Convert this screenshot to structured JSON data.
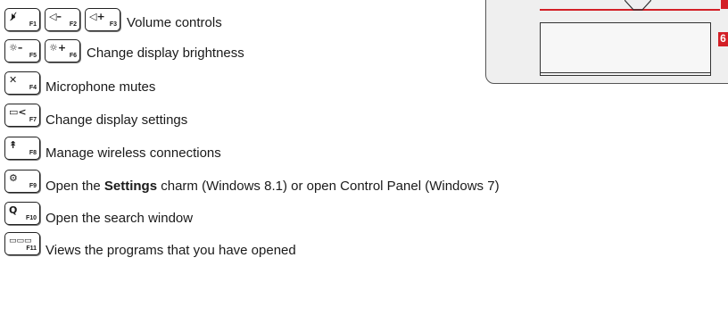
{
  "keys": {
    "mute": {
      "glyph": "🕨̸",
      "fn": "F1",
      "icon": "speaker-mute-icon"
    },
    "vol_down": {
      "glyph": "◁–",
      "fn": "F2",
      "icon": "volume-down-icon"
    },
    "vol_up": {
      "glyph": "◁+",
      "fn": "F3",
      "icon": "volume-up-icon"
    },
    "mic_mute": {
      "glyph": "✕",
      "fn": "F4",
      "icon": "microphone-mute-icon"
    },
    "bright_down": {
      "glyph": "☼–",
      "fn": "F5",
      "icon": "brightness-down-icon"
    },
    "bright_up": {
      "glyph": "☼+",
      "fn": "F6",
      "icon": "brightness-up-icon"
    },
    "display": {
      "glyph": "▭<",
      "fn": "F7",
      "icon": "display-switch-icon"
    },
    "wireless": {
      "glyph": "↟",
      "fn": "F8",
      "icon": "wireless-icon"
    },
    "settings": {
      "glyph": "⚙",
      "fn": "F9",
      "icon": "gear-icon"
    },
    "search": {
      "glyph": "Q",
      "fn": "F10",
      "icon": "search-icon"
    },
    "programs": {
      "glyph": "▭▭▭",
      "fn": "F11",
      "icon": "task-view-icon"
    }
  },
  "descriptions": {
    "volume": "Volume controls",
    "brightness": "Change display brightness",
    "microphone": "Microphone mutes",
    "display": "Change display settings",
    "wireless": "Manage wireless connections",
    "settings_pre": "Open the ",
    "settings_bold": "Settings",
    "settings_post": " charm (Windows 8.1) or open Control Panel (Windows 7)",
    "search": "Open the search window",
    "programs": "Views the programs that you have opened"
  },
  "panel": {
    "marker_top": "",
    "marker_bottom": "6"
  },
  "colors": {
    "accent_red": "#d31f26",
    "panel_bg": "#efefef"
  }
}
